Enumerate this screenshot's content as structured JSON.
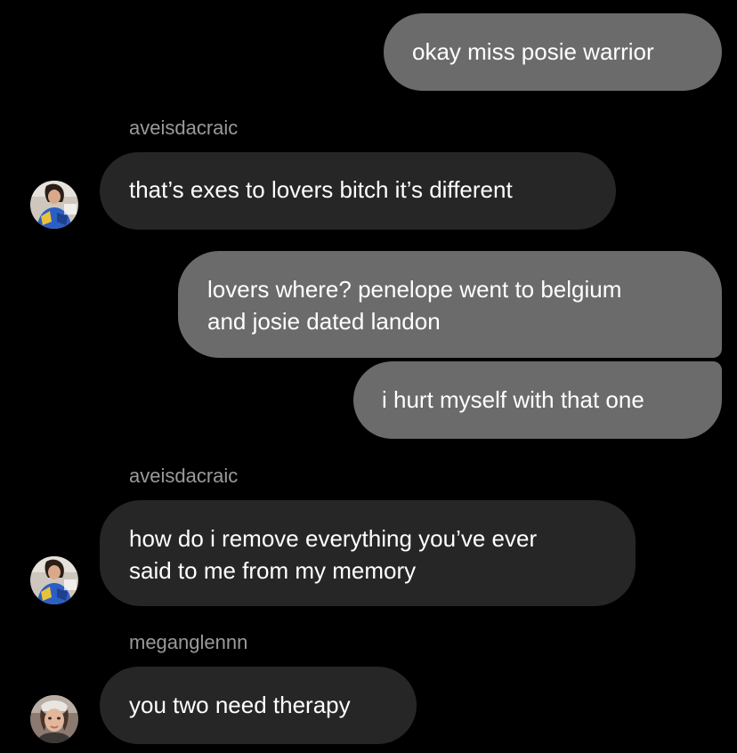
{
  "colors": {
    "background": "#000000",
    "outgoing_bubble": "#6b6b6b",
    "incoming_bubble": "#262626",
    "sender_name": "#9a9a9a",
    "text": "#ffffff"
  },
  "messages": [
    {
      "direction": "outgoing",
      "text": "okay miss posie warrior"
    },
    {
      "direction": "incoming",
      "sender": "aveisdacraic",
      "avatar": "avatar-aveisdacraic",
      "text": "that’s exes to lovers bitch it’s different"
    },
    {
      "direction": "outgoing",
      "lines": [
        "lovers where? penelope went to belgium",
        "and josie dated landon"
      ]
    },
    {
      "direction": "outgoing",
      "text": "i hurt myself with that one"
    },
    {
      "direction": "incoming",
      "sender": "aveisdacraic",
      "avatar": "avatar-aveisdacraic",
      "lines": [
        "how do i remove everything you’ve ever",
        "said to me from my memory"
      ]
    },
    {
      "direction": "incoming",
      "sender": "meganglennn",
      "avatar": "avatar-meganglennn",
      "text": "you two need therapy"
    }
  ]
}
